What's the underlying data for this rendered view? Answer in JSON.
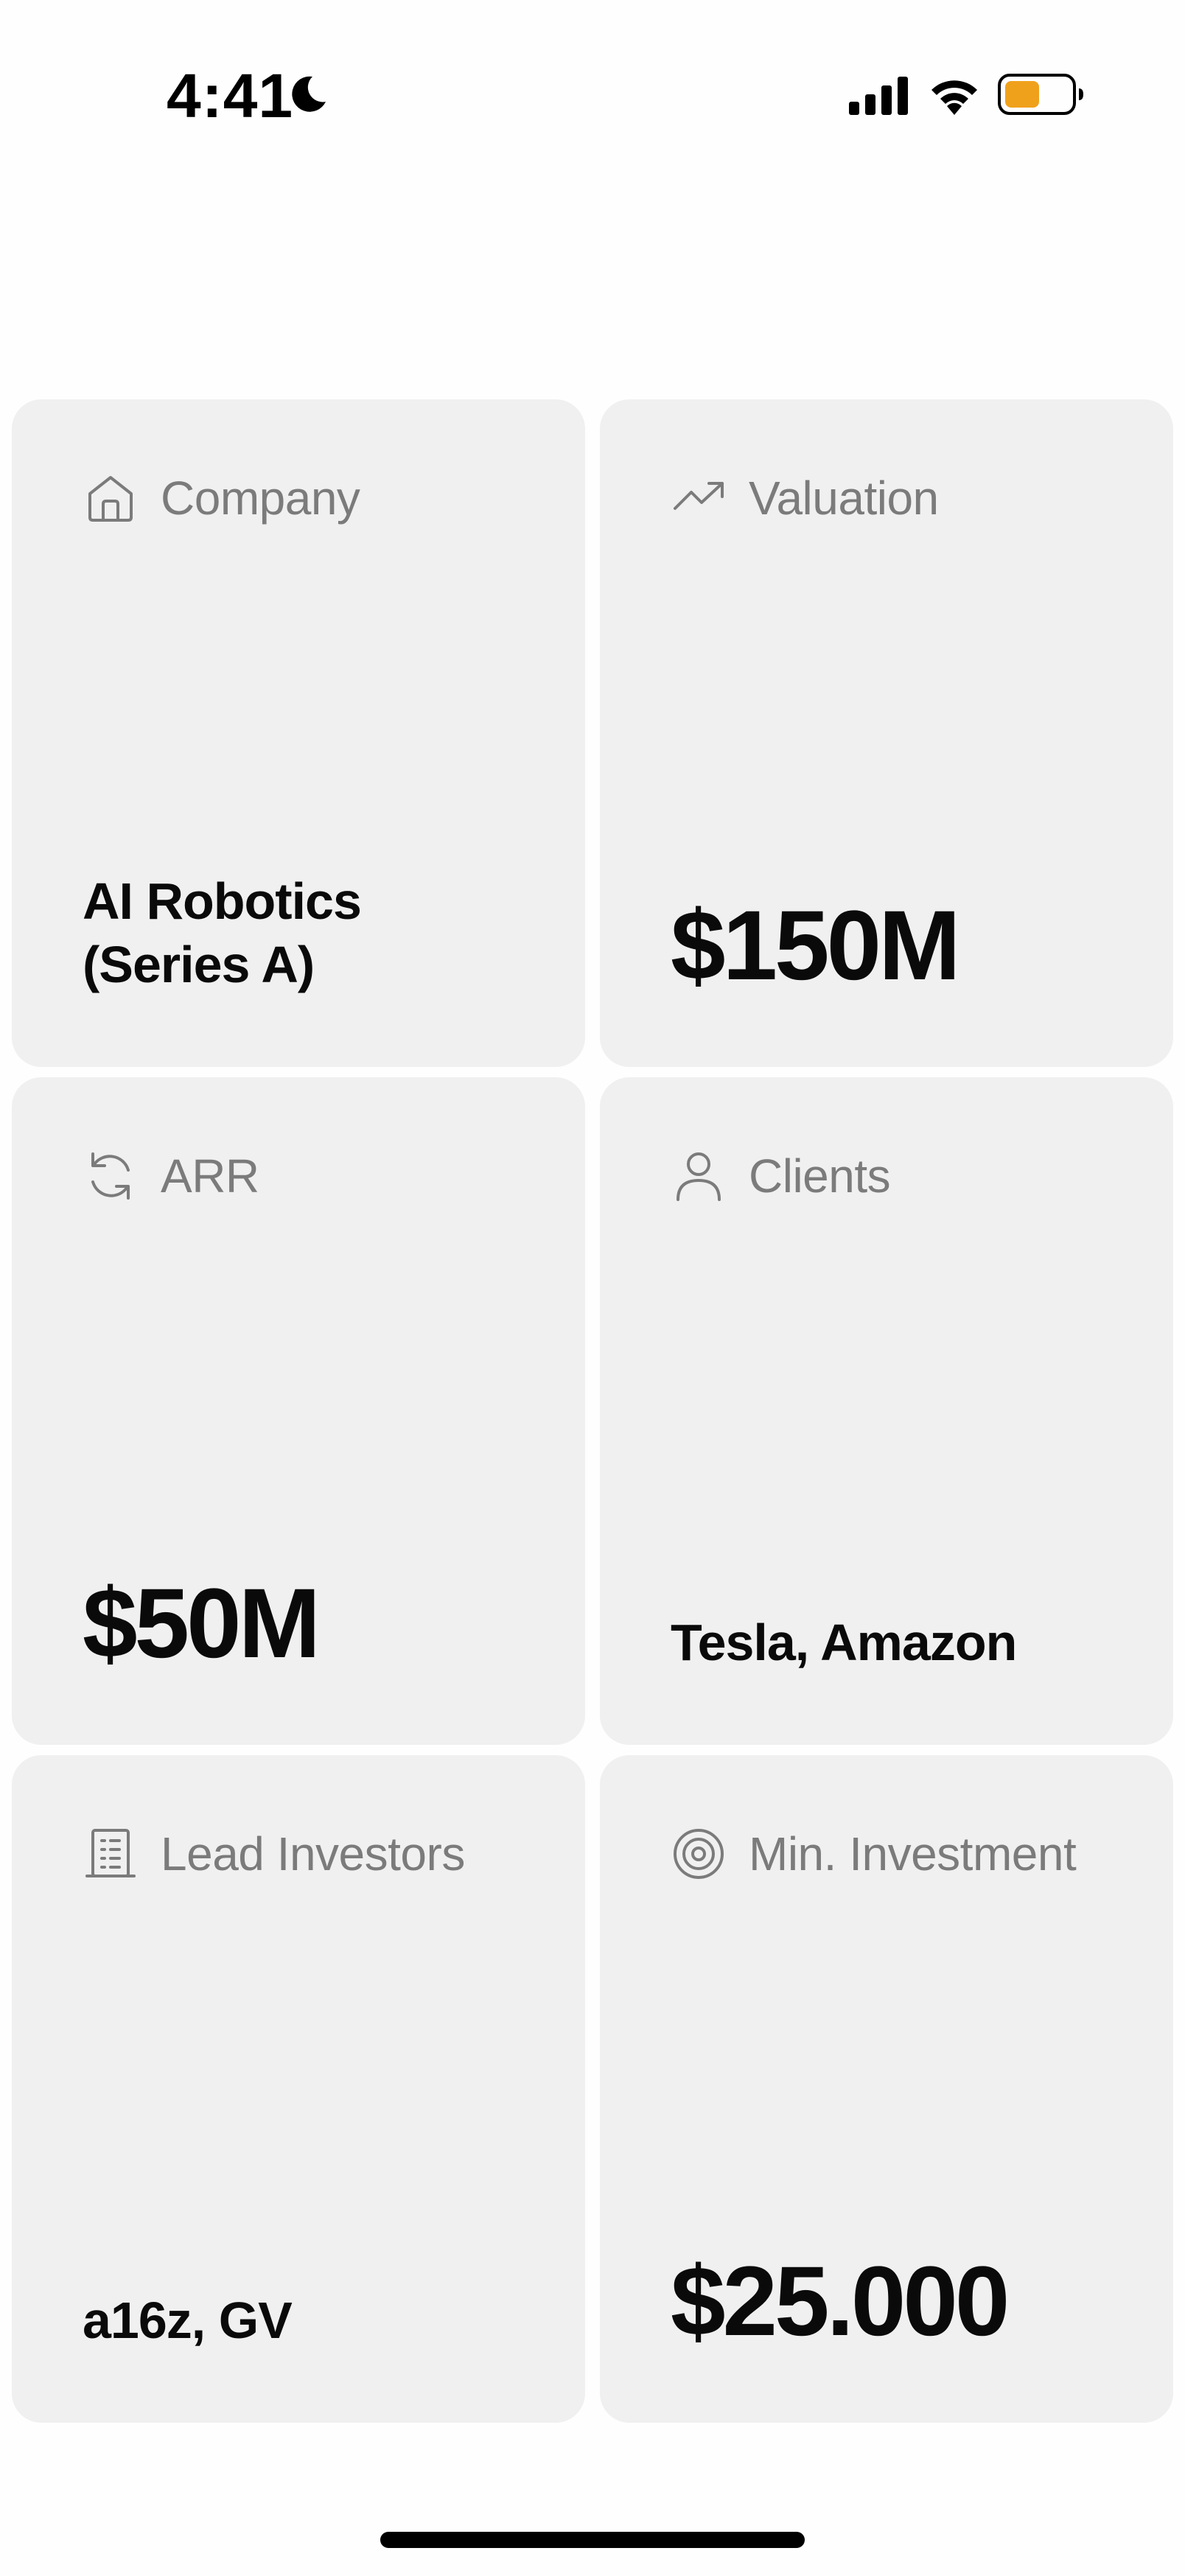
{
  "status_bar": {
    "time": "4:41",
    "moon_icon": "moon-icon",
    "signal_icon": "cellular-signal-icon",
    "wifi_icon": "wifi-icon",
    "battery_icon": "battery-icon",
    "battery_color": "#f0a11c"
  },
  "cards": [
    {
      "label": "Company",
      "icon": "home-icon",
      "value": "AI Robotics (Series A)"
    },
    {
      "label": "Valuation",
      "icon": "trending-up-icon",
      "value": "$150M"
    },
    {
      "label": "ARR",
      "icon": "refresh-icon",
      "value": "$50M"
    },
    {
      "label": "Clients",
      "icon": "user-icon",
      "value": "Tesla, Amazon"
    },
    {
      "label": "Lead Investors",
      "icon": "building-icon",
      "value": "a16z, GV"
    },
    {
      "label": "Min. Investment",
      "icon": "target-icon",
      "value": "$25.000"
    }
  ],
  "colors": {
    "card_background": "#f0f0f0",
    "label_text": "#7b7b7b",
    "value_text": "#0a0a0a"
  }
}
